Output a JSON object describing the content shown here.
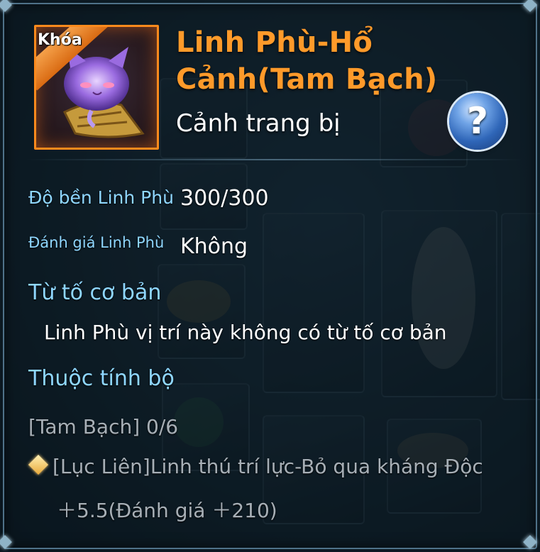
{
  "item": {
    "lock_badge": "Khóa",
    "title": "Linh Phù-Hổ Cảnh(Tam Bạch)",
    "subtitle": "Cảnh trang bị",
    "help_label": "?"
  },
  "stats": [
    {
      "label": "Độ bền Linh Phù",
      "value": "300/300"
    },
    {
      "label": "Đánh giá Linh Phù",
      "value": "Không"
    }
  ],
  "basic_affix": {
    "heading": "Từ tố cơ bản",
    "text": "Linh Phù vị trí này không có từ tố cơ bản"
  },
  "set_attribute": {
    "heading": "Thuộc tính bộ",
    "progress": "[Tam Bạch] 0/6",
    "bonus_line_1": "[Lục Liên]Linh thú trí lực-Bỏ qua kháng Độc",
    "bonus_line_2": "＋5.5(Đánh giá ＋210)"
  },
  "colors": {
    "title": "#ff9a2a",
    "label": "#8fd7ff",
    "value": "#ffffff",
    "muted": "#a7afb6",
    "icon_border": "#ff8a1c"
  },
  "icons": {
    "help": "question-mark-icon",
    "item": "spirit-cat-talisman-icon",
    "bullet": "diamond-bullet-icon"
  }
}
